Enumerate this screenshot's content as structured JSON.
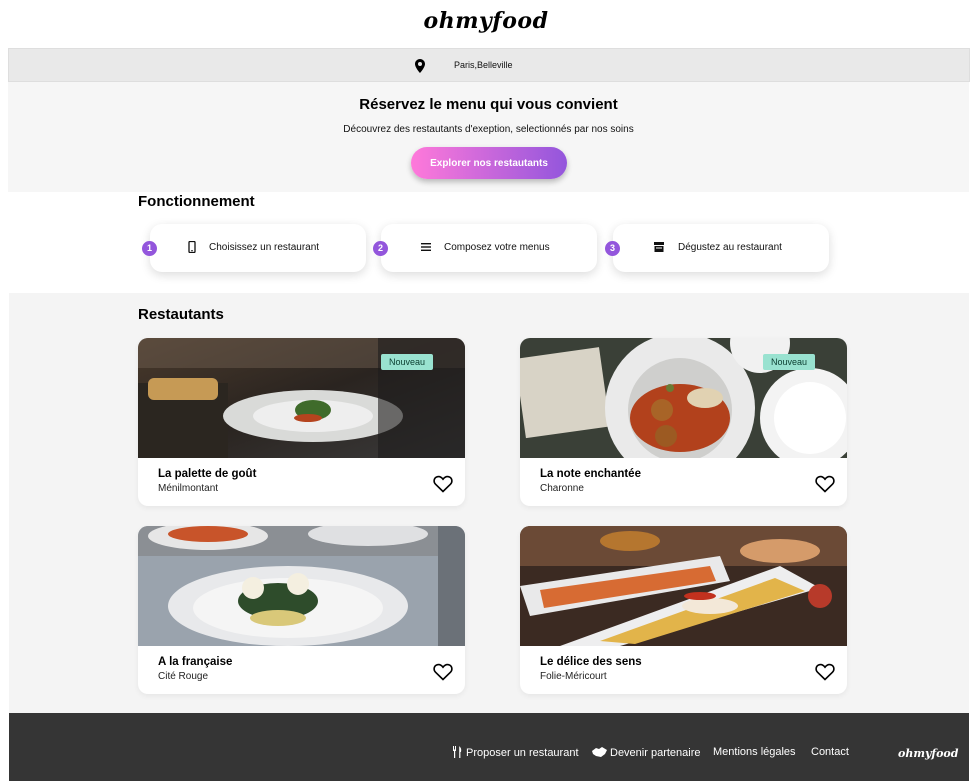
{
  "header": {
    "logo": "ohmyfood"
  },
  "location": {
    "text": "Paris,Belleville",
    "icon": "location-pin-icon"
  },
  "hero": {
    "title": "Réservez le menu qui vous convient",
    "subtitle": "Découvrez des restautants d'exeption, selectionnés par nos soins",
    "button_label": "Explorer nos restautants"
  },
  "how_it_works": {
    "title": "Fonctionnement",
    "steps": [
      {
        "number": "1",
        "icon": "mobile-phone-icon",
        "label": "Choisissez un restaurant"
      },
      {
        "number": "2",
        "icon": "list-icon",
        "label": "Composez votre menus"
      },
      {
        "number": "3",
        "icon": "store-icon",
        "label": "Dégustez au restaurant"
      }
    ]
  },
  "restaurants": {
    "title": "Restautants",
    "items": [
      {
        "name": "La palette de goût",
        "area": "Ménilmontant",
        "badge": "Nouveau"
      },
      {
        "name": "La note enchantée",
        "area": "Charonne",
        "badge": "Nouveau"
      },
      {
        "name": "A la française",
        "area": "Cité Rouge",
        "badge": ""
      },
      {
        "name": "Le délice des sens",
        "area": "Folie-Méricourt",
        "badge": ""
      }
    ]
  },
  "footer": {
    "links": [
      {
        "label": "Proposer un restaurant",
        "icon": "utensils-icon"
      },
      {
        "label": "Devenir partenaire",
        "icon": "handshake-icon"
      },
      {
        "label": "Mentions légales",
        "icon": ""
      },
      {
        "label": "Contact",
        "icon": ""
      }
    ],
    "logo": "ohmyfood"
  },
  "colors": {
    "accent_start": "#ff79da",
    "accent_end": "#9356dc",
    "badge_bg": "#99e2d0",
    "footer_bg": "#353535"
  }
}
